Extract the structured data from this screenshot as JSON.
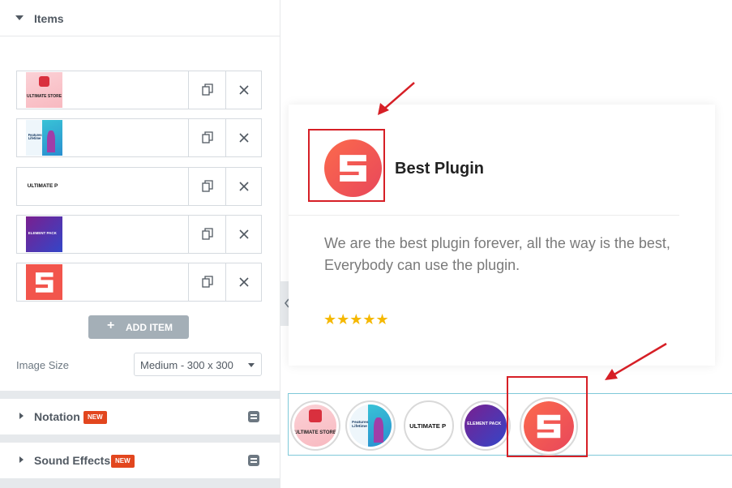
{
  "panel": {
    "items_title": "Items",
    "repeater_items": [
      {
        "thumb": "ultimate-store-thumbnail",
        "thumb_text": "ULTIMATE STORE"
      },
      {
        "thumb": "features-person-thumbnail",
        "thumb_text": "Features Lifetime"
      },
      {
        "thumb": "ultimate-pack-thumbnail",
        "thumb_text": "ULTIMATE P"
      },
      {
        "thumb": "element-pack-thumbnail",
        "thumb_text": "ELEMENT PACK"
      },
      {
        "thumb": "s-logo-thumbnail",
        "thumb_text": ""
      }
    ],
    "duplicate_icon": "copy-icon",
    "remove_icon": "close-icon",
    "add_item_label": "ADD ITEM",
    "image_size_label": "Image Size",
    "image_size_value": "Medium - 300 x 300",
    "sections": [
      {
        "name": "Notation",
        "badge": "NEW"
      },
      {
        "name": "Sound Effects",
        "badge": "NEW"
      }
    ]
  },
  "preview": {
    "heading": "Best Plugin",
    "text": "We are the best plugin forever, all the way is the best, Everybody can use the plugin.",
    "stars": "★★★★★",
    "rating": 5,
    "nav_thumbs": [
      {
        "thumb": "ultimate-store-thumbnail",
        "thumb_text": "ULTIMATE STORE"
      },
      {
        "thumb": "features-person-thumbnail",
        "thumb_text": "Features Lifetime"
      },
      {
        "thumb": "ultimate-pack-thumbnail",
        "thumb_text": "ULTIMATE P"
      },
      {
        "thumb": "element-pack-thumbnail",
        "thumb_text": "ELEMENT PACK"
      },
      {
        "thumb": "s-logo-thumbnail",
        "thumb_text": "",
        "active": true
      }
    ]
  },
  "colors": {
    "accent_red": "#d61f26",
    "logo_gradient_start": "#fc6a4c",
    "logo_gradient_end": "#e8475b",
    "star": "#f5b800",
    "nav_border": "#7fc9d9"
  }
}
